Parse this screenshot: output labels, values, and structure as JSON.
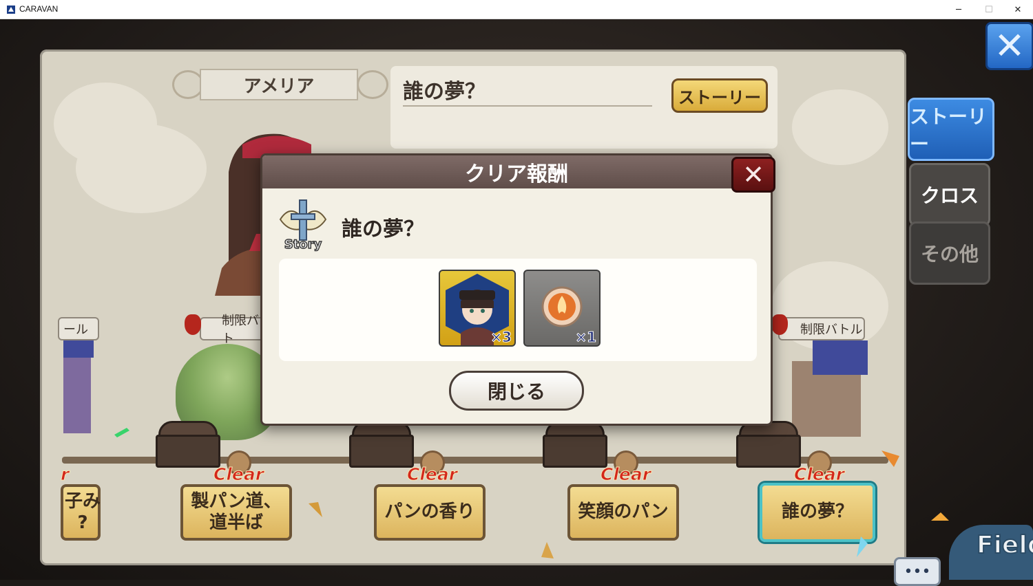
{
  "window": {
    "title": "CARAVAN",
    "minimize": "─",
    "maximize": "☐",
    "close": "✕"
  },
  "character_panel": {
    "name": "アメリア"
  },
  "story_panel": {
    "title": "誰の夢？",
    "button": "ストーリー"
  },
  "side_tabs": [
    "ストーリー",
    "クロス",
    "その他"
  ],
  "top_close": "✕",
  "battles": [
    {
      "label": "ール"
    },
    {
      "label": "制限バト"
    },
    {
      "label": "制限バトル"
    }
  ],
  "stages": [
    {
      "clear": "r",
      "label": "子み\n?"
    },
    {
      "clear": "Clear",
      "label": "製パン道、\n道半ば"
    },
    {
      "clear": "Clear",
      "label": "パンの香り"
    },
    {
      "clear": "Clear",
      "label": "笑顔のパン"
    },
    {
      "clear": "Clear",
      "label": "誰の夢？"
    }
  ],
  "modal": {
    "header": "クリア報酬",
    "close": "✕",
    "story_icon_label": "Story",
    "title": "誰の夢？",
    "rewards": [
      {
        "type": "character",
        "icon": "character-portrait",
        "count": "×3"
      },
      {
        "type": "item",
        "icon": "fire-orb-icon",
        "count": "×1"
      }
    ],
    "close_button": "閉じる"
  },
  "bottom": {
    "more": "•••",
    "field": "Field"
  },
  "colors": {
    "accent_blue": "#2367c4",
    "clear_red": "#d3261a",
    "stage_gold": "#dcb45d",
    "modal_header": "#6b5753"
  }
}
